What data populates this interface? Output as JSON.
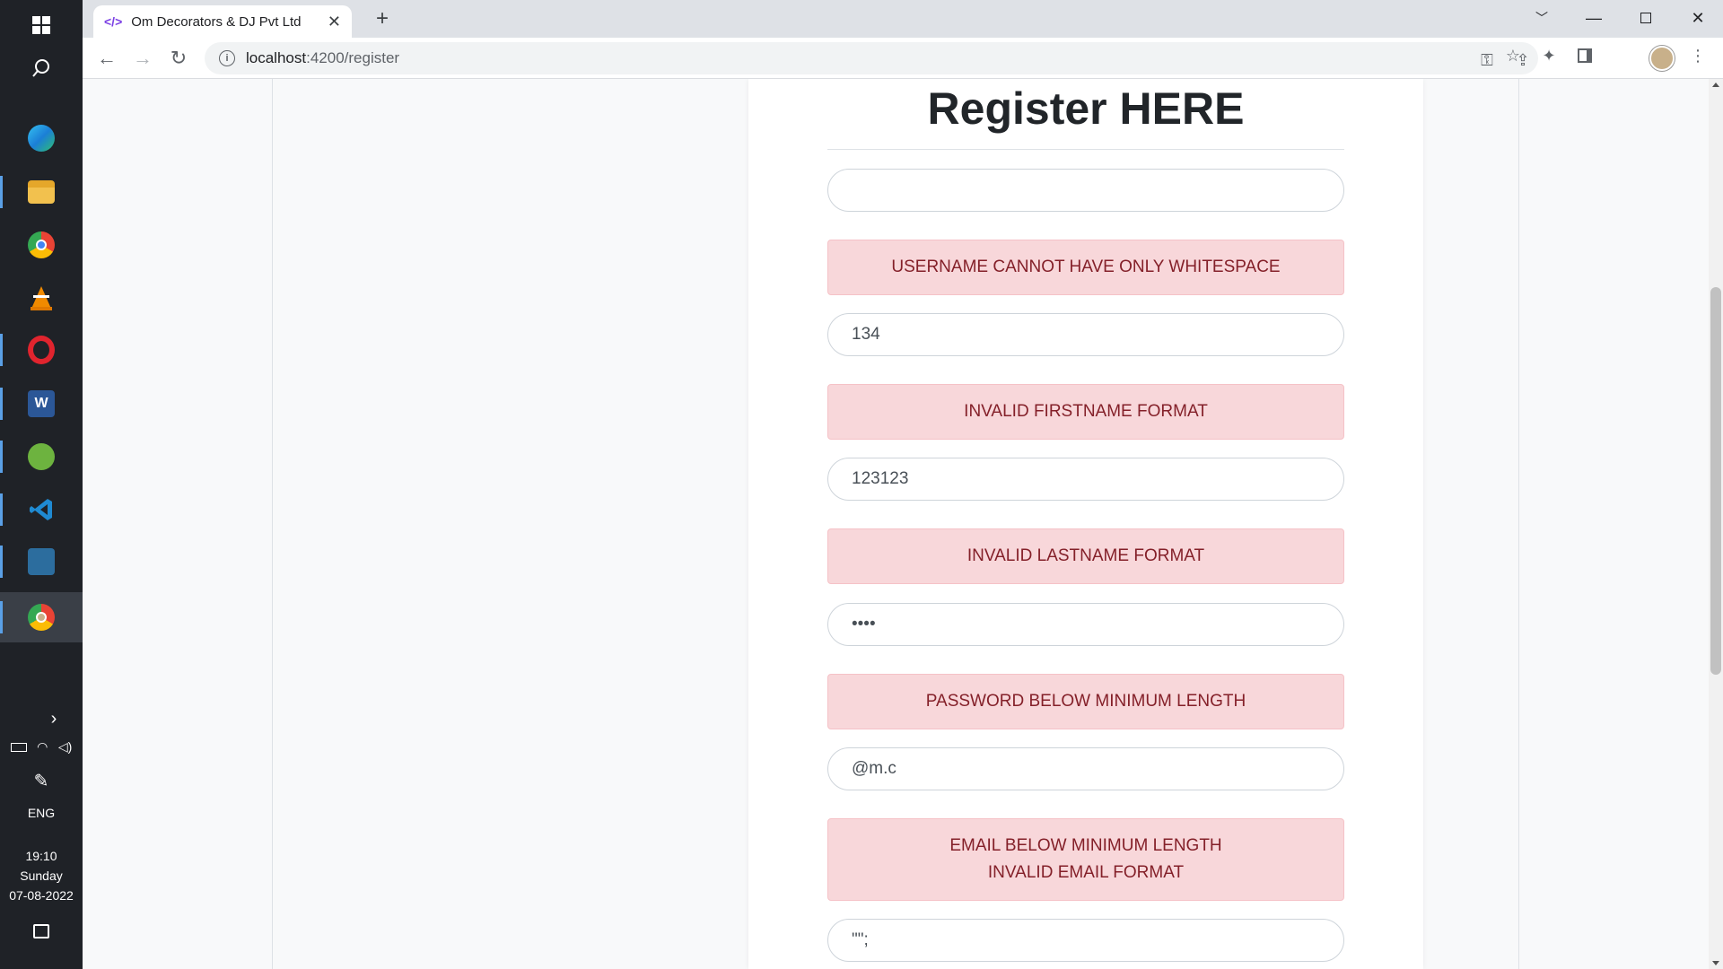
{
  "taskbar": {
    "apps": [
      {
        "icon": "edge-icon",
        "color": "#1fa2e8"
      },
      {
        "icon": "file-explorer-icon",
        "color": "#f2c14e"
      },
      {
        "icon": "chrome-icon",
        "color": "#e94335"
      },
      {
        "icon": "vlc-icon",
        "color": "#f08a00"
      },
      {
        "icon": "opera-icon",
        "color": "#e0242e"
      },
      {
        "icon": "word-icon",
        "color": "#2b5797"
      },
      {
        "icon": "spring-tool-icon",
        "color": "#6db33f"
      },
      {
        "icon": "vscode-icon",
        "color": "#1f8ad2"
      },
      {
        "icon": "mysql-workbench-icon",
        "color": "#2c6d9e"
      },
      {
        "icon": "chrome-profile-icon",
        "color": "#e94335"
      }
    ],
    "language": "ENG",
    "time": "19:10",
    "day": "Sunday",
    "date": "07-08-2022",
    "expand_glyph": "›"
  },
  "browser": {
    "tab_title": "Om Decorators & DJ Pvt Ltd",
    "favicon_glyph": "</>",
    "url_host": "localhost",
    "url_path": ":4200/register"
  },
  "page": {
    "title": "Register HERE",
    "fields": {
      "username_value": "",
      "firstname_value": "134",
      "lastname_value": "123123",
      "password_value": "••••",
      "email_value": "@m.c",
      "next_value": "\"\";"
    },
    "alerts": {
      "username": "USERNAME CANNOT HAVE ONLY WHITESPACE",
      "firstname": "INVALID FIRSTNAME FORMAT",
      "lastname": "INVALID LASTNAME FORMAT",
      "password": "PASSWORD BELOW MINIMUM LENGTH",
      "email_line1": "EMAIL BELOW MINIMUM LENGTH",
      "email_line2": "INVALID EMAIL FORMAT"
    }
  }
}
